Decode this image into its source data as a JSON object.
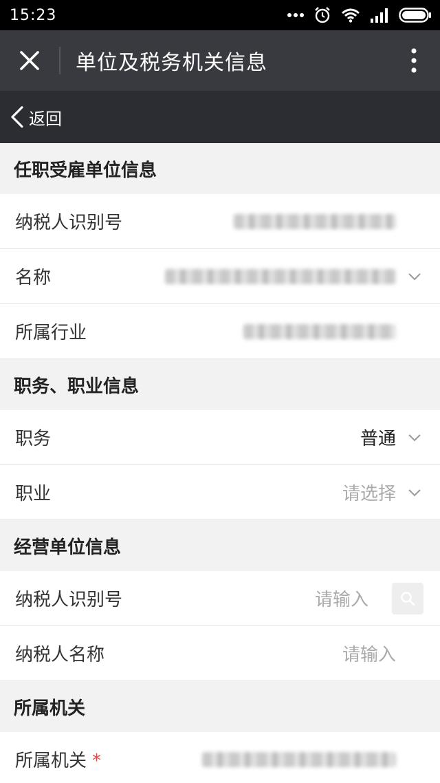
{
  "status_bar": {
    "time": "15:23"
  },
  "title_bar": {
    "title": "单位及税务机关信息"
  },
  "nav_bar": {
    "back_label": "返回"
  },
  "sections": {
    "employer": {
      "title": "任职受雇单位信息",
      "taxpayer_id_label": "纳税人识别号",
      "name_label": "名称",
      "industry_label": "所属行业"
    },
    "position": {
      "title": "职务、职业信息",
      "duty_label": "职务",
      "duty_value": "普通",
      "occupation_label": "职业",
      "occupation_placeholder": "请选择"
    },
    "business": {
      "title": "经营单位信息",
      "taxpayer_id_label": "纳税人识别号",
      "taxpayer_id_placeholder": "请输入",
      "taxpayer_name_label": "纳税人名称",
      "taxpayer_name_placeholder": "请输入"
    },
    "authority": {
      "title": "所属机关",
      "authority_label": "所属机关",
      "required_mark": "*"
    }
  }
}
